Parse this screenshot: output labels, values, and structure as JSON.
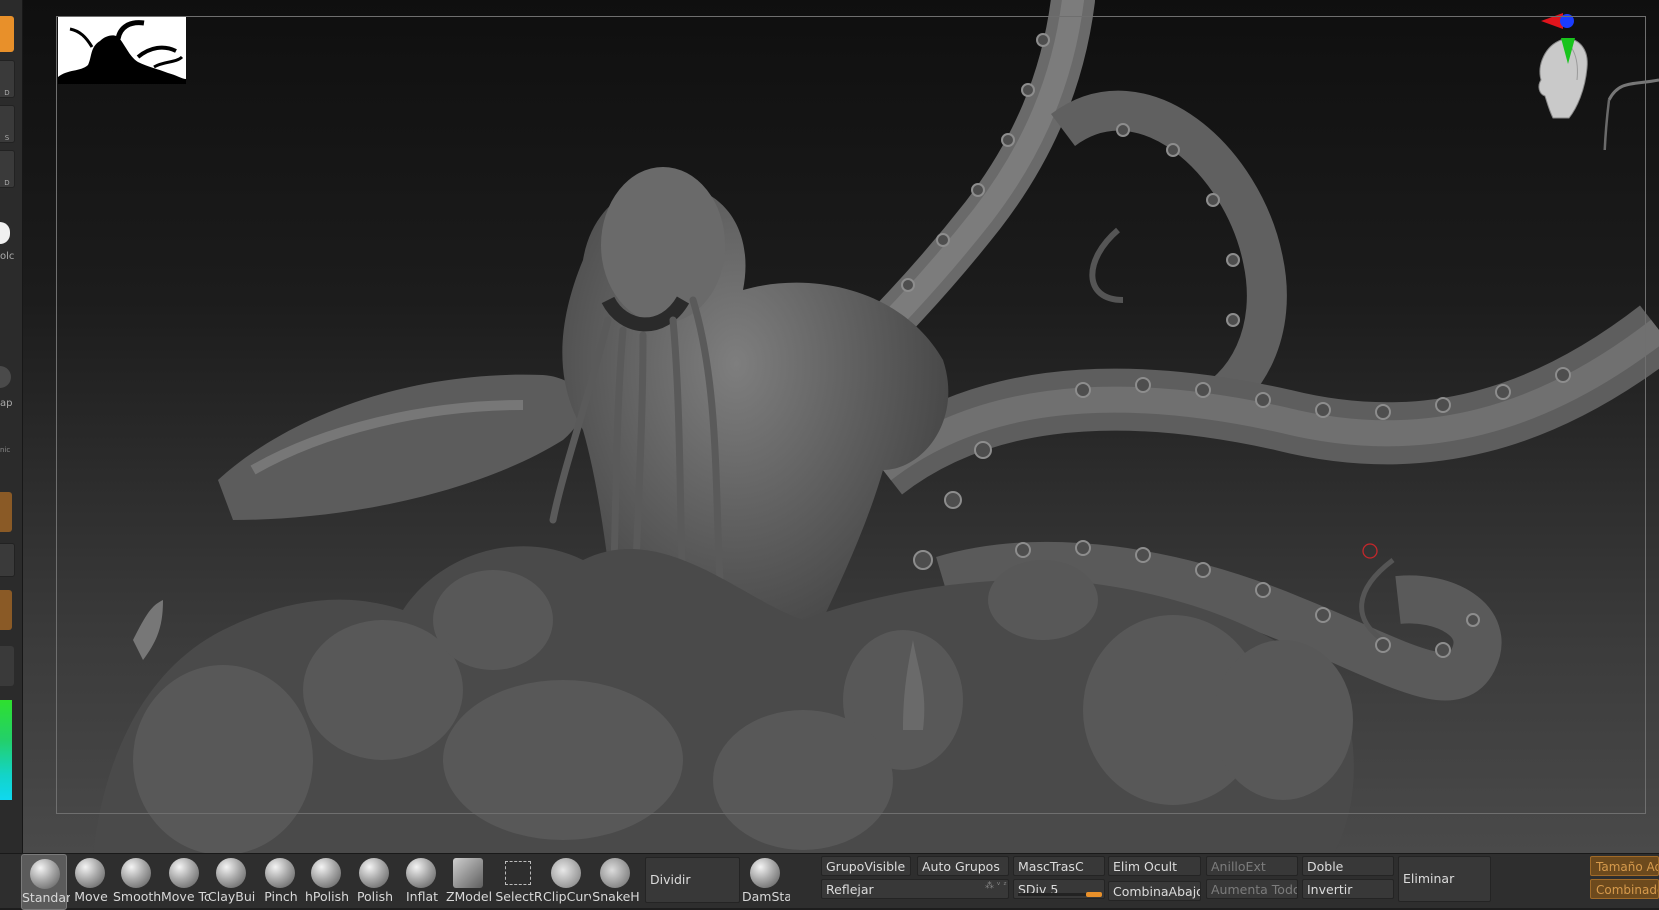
{
  "left_tray": {
    "labels": [
      "D",
      "S",
      "D",
      "olc",
      "ap",
      "nic"
    ]
  },
  "canvas": {
    "accent_orange": "#e8902a",
    "axis_colors": {
      "x": "#e0141c",
      "y": "#18c41c",
      "z": "#1a3cff"
    }
  },
  "brushes": [
    {
      "label": "Standar",
      "icon": "standard-brush-icon",
      "active": true
    },
    {
      "label": "Move",
      "icon": "move-brush-icon"
    },
    {
      "label": "Smooth",
      "icon": "smooth-brush-icon"
    },
    {
      "label": "Move Tc",
      "icon": "move-topological-brush-icon"
    },
    {
      "label": "ClayBuil",
      "icon": "claybuildup-brush-icon"
    },
    {
      "label": "Pinch",
      "icon": "pinch-brush-icon"
    },
    {
      "label": "hPolish",
      "icon": "hpolish-brush-icon"
    },
    {
      "label": "Polish",
      "icon": "polish-brush-icon"
    },
    {
      "label": "Inflat",
      "icon": "inflate-brush-icon"
    },
    {
      "label": "ZModel",
      "icon": "zmodeler-brush-icon"
    },
    {
      "label": "SelectR",
      "icon": "selectrect-brush-icon"
    },
    {
      "label": "ClipCurv",
      "icon": "clipcurve-brush-icon"
    },
    {
      "label": "SnakeH",
      "icon": "snakehook-brush-icon"
    }
  ],
  "shelf": {
    "dividir": "Dividir",
    "damstandard": "DamSta",
    "grupo_visible": "GrupoVisible",
    "auto_grupos": "Auto Grupos",
    "reflejar": "Reflejar",
    "masc_tras": "MascTrasC",
    "sdiv": "SDiv 5",
    "elim_ocult": "Elim Ocult",
    "combina_abajo": "CombinaAbajo",
    "anillo_ext": "AnilloExt",
    "aumenta_todo": "Aumenta Todo",
    "doble": "Doble",
    "invertir": "Invertir",
    "eliminar": "Eliminar",
    "tamano": "Tamaño Ad",
    "combinado": "Combinado"
  }
}
